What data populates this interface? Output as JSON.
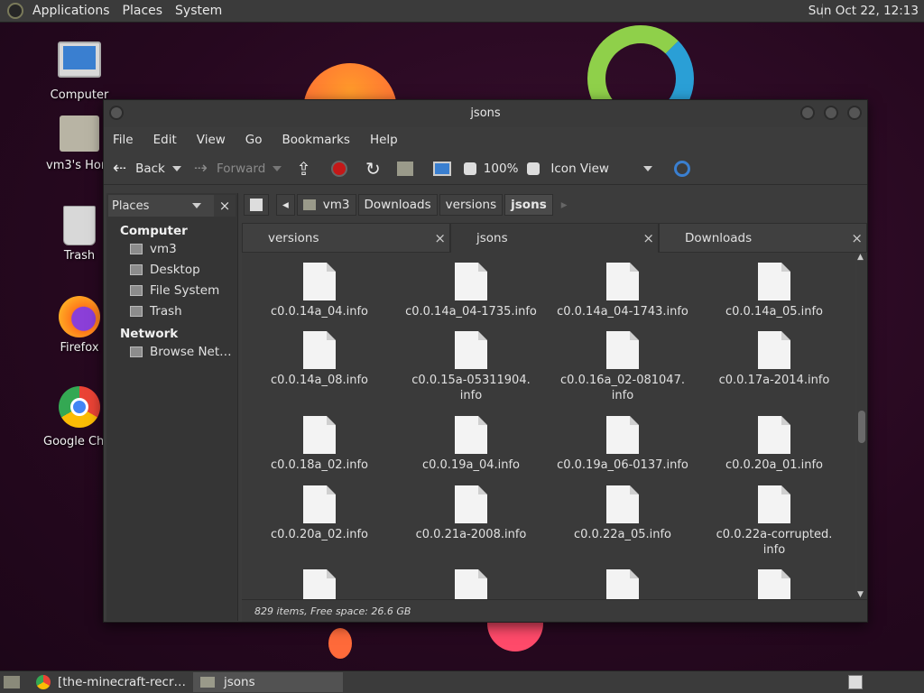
{
  "top_panel": {
    "menus": [
      "Applications",
      "Places",
      "System"
    ],
    "clock": "Sun Oct 22, 12:13"
  },
  "desktop_icons": [
    {
      "label": "Computer",
      "icon": "computer-icon"
    },
    {
      "label": "vm3's Home",
      "icon": "home-folder-icon"
    },
    {
      "label": "Trash",
      "icon": "trash-icon"
    },
    {
      "label": "Firefox",
      "icon": "firefox-icon"
    },
    {
      "label": "Google Chrome",
      "icon": "chrome-icon"
    }
  ],
  "window": {
    "title": "jsons",
    "menubar": [
      "File",
      "Edit",
      "View",
      "Go",
      "Bookmarks",
      "Help"
    ],
    "toolbar": {
      "back": "Back",
      "forward": "Forward",
      "zoom": "100%",
      "view_mode": "Icon View"
    },
    "sidebar": {
      "selector": "Places",
      "sections": [
        {
          "title": "Computer",
          "items": [
            "vm3",
            "Desktop",
            "File System",
            "Trash"
          ]
        },
        {
          "title": "Network",
          "items": [
            "Browse Net…"
          ]
        }
      ]
    },
    "pathbar": [
      "vm3",
      "Downloads",
      "versions",
      "jsons"
    ],
    "tabs": [
      "versions",
      "jsons",
      "Downloads"
    ],
    "active_tab": "jsons",
    "files": [
      "c0.0.14a_04.info",
      "c0.0.14a_04-1735.info",
      "c0.0.14a_04-1743.info",
      "c0.0.14a_05.info",
      "c0.0.14a_08.info",
      "c0.0.15a-05311904.\ninfo",
      "c0.0.16a_02-081047.\ninfo",
      "c0.0.17a-2014.info",
      "c0.0.18a_02.info",
      "c0.0.19a_04.info",
      "c0.0.19a_06-0137.info",
      "c0.0.20a_01.info",
      "c0.0.20a_02.info",
      "c0.0.21a-2008.info",
      "c0.0.22a_05.info",
      "c0.0.22a-corrupted.\ninfo",
      "",
      "",
      "",
      ""
    ],
    "status": "829 items, Free space: 26.6 GB"
  },
  "taskbar": {
    "tasks": [
      "[the-minecraft-recr…",
      "jsons"
    ]
  }
}
